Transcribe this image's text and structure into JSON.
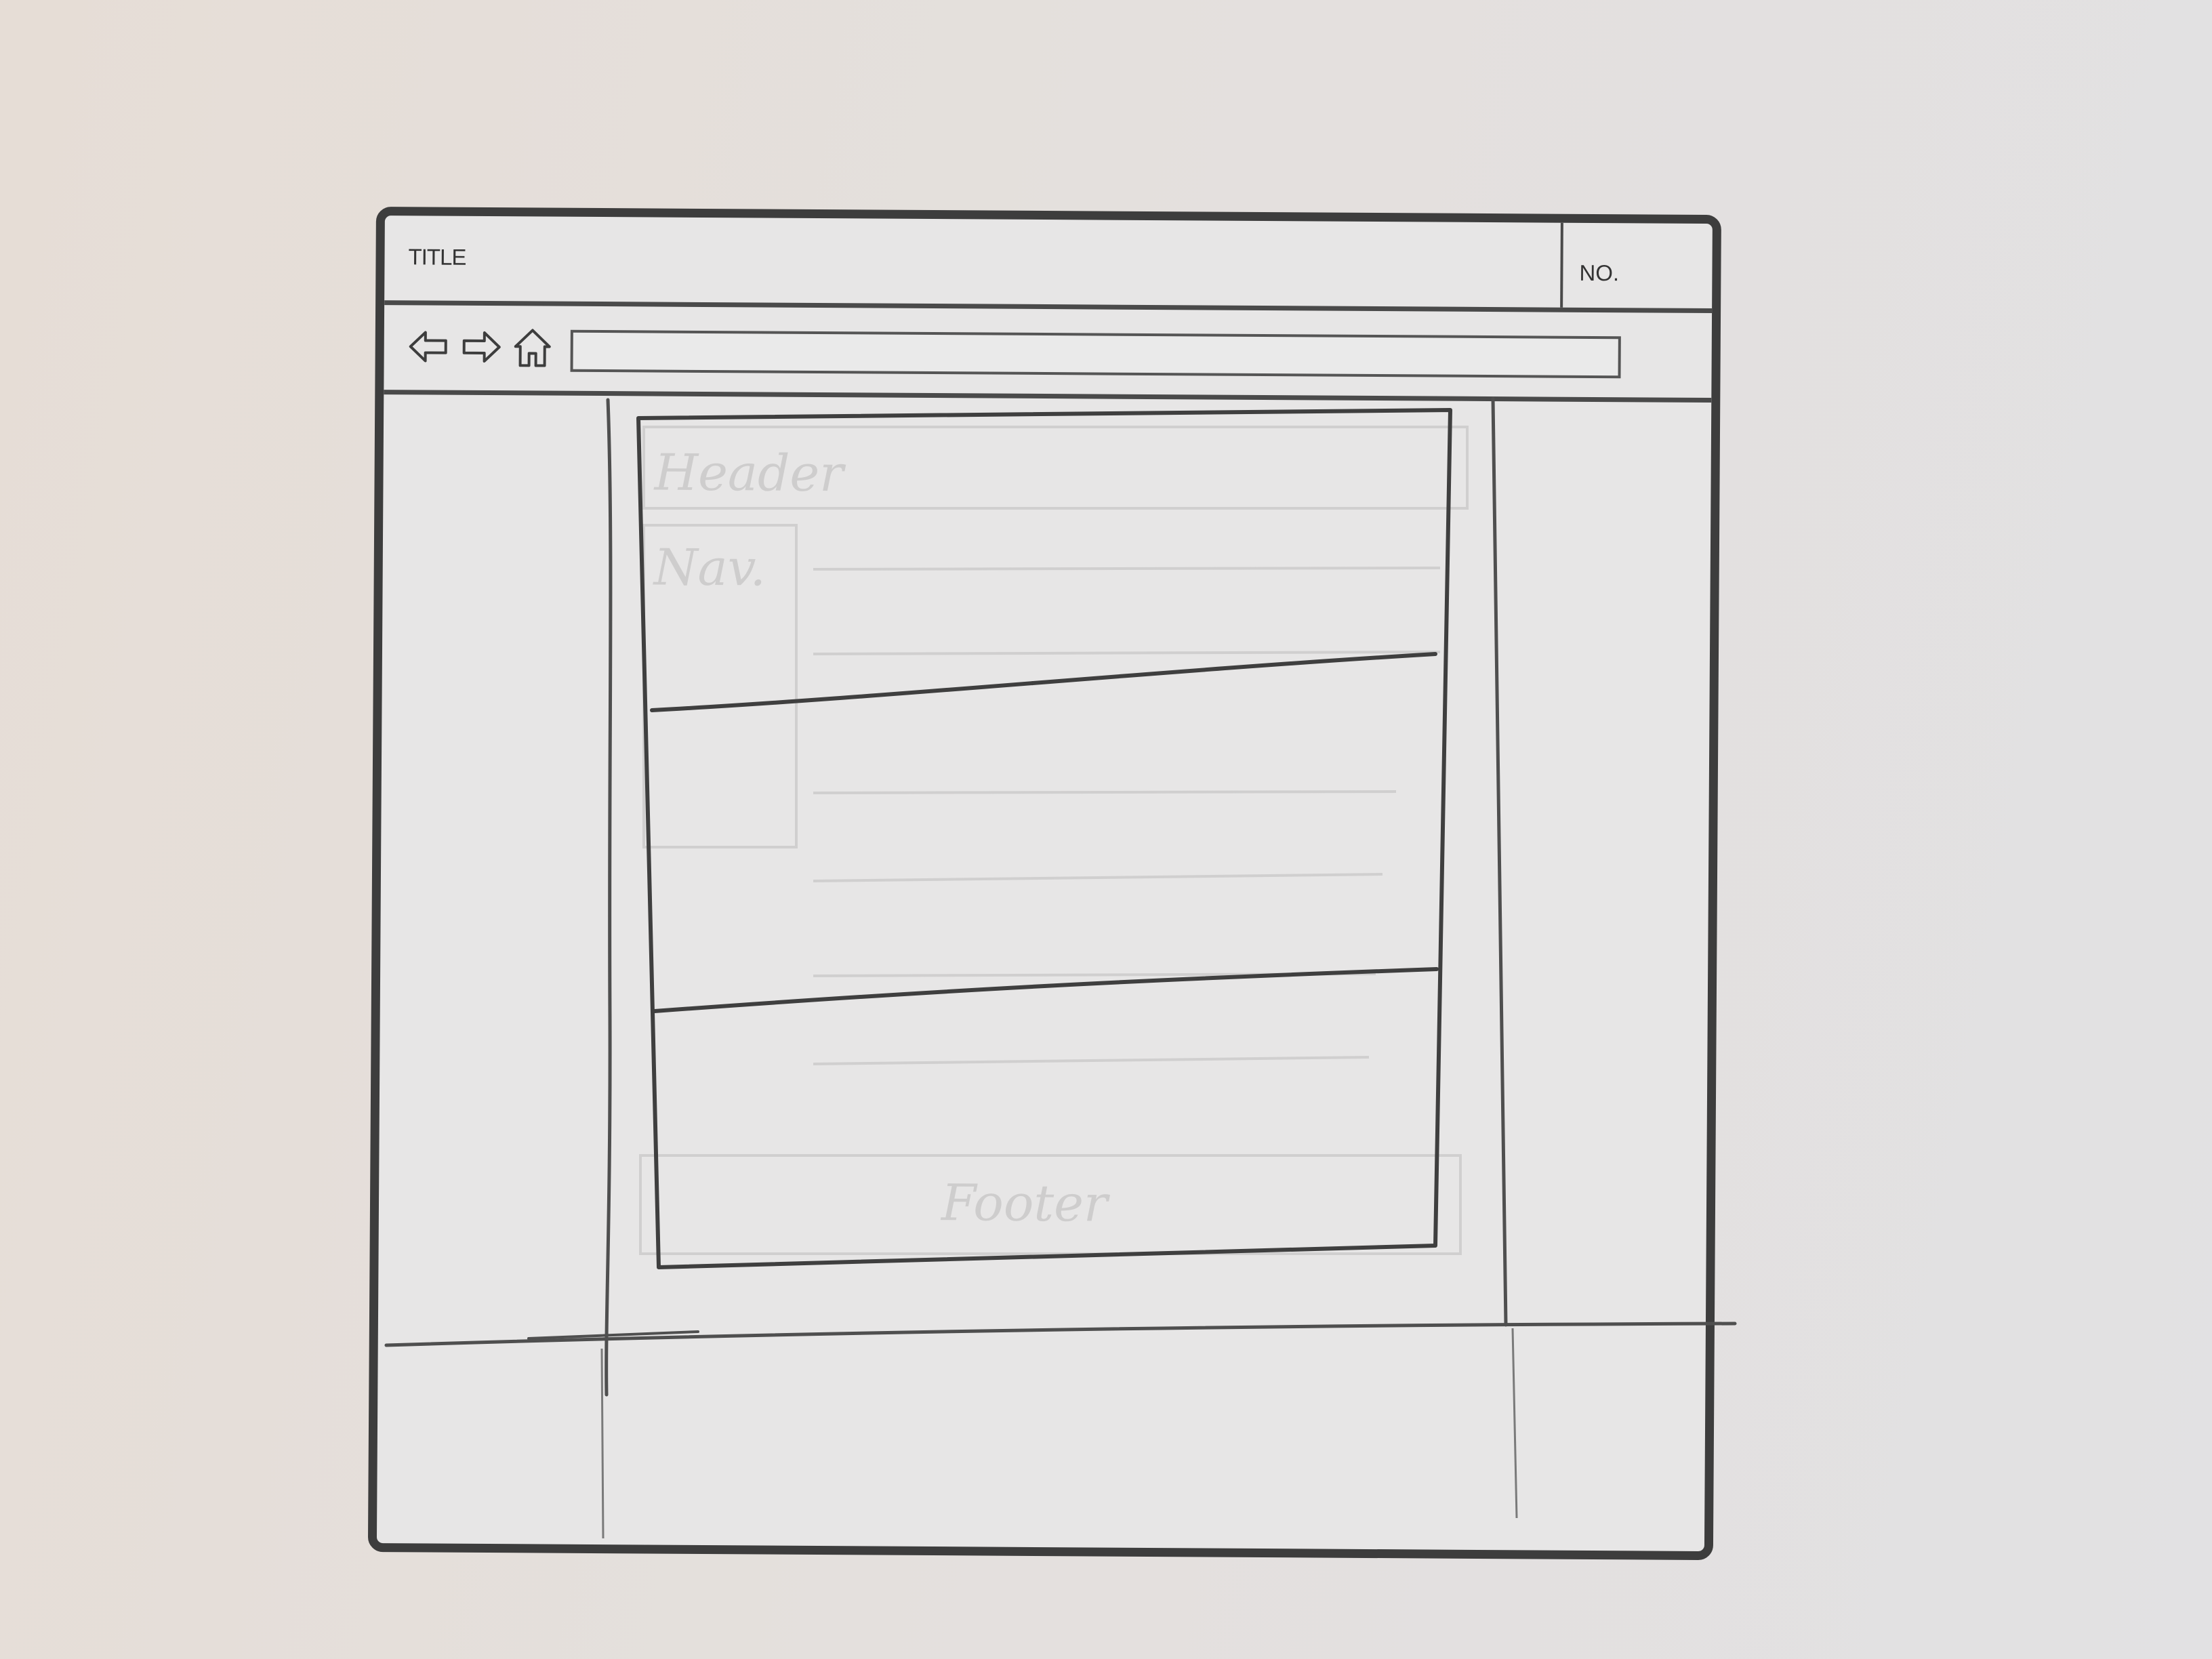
{
  "window": {
    "title": "TITLE",
    "number_label": "NO."
  },
  "navigation": {
    "back_icon": "back-arrow-icon",
    "forward_icon": "forward-arrow-icon",
    "home_icon": "home-icon",
    "address_value": ""
  },
  "main": {
    "sections": [
      {
        "label": ""
      },
      {
        "label": ""
      },
      {
        "label": ""
      }
    ],
    "ghost_labels": {
      "header": "Header",
      "nav": "Nav.",
      "footer": "Footer"
    }
  },
  "colors": {
    "frame": "#3d3d3d",
    "pencil": "#4f4f4f",
    "paper": "#e4e0dd"
  }
}
